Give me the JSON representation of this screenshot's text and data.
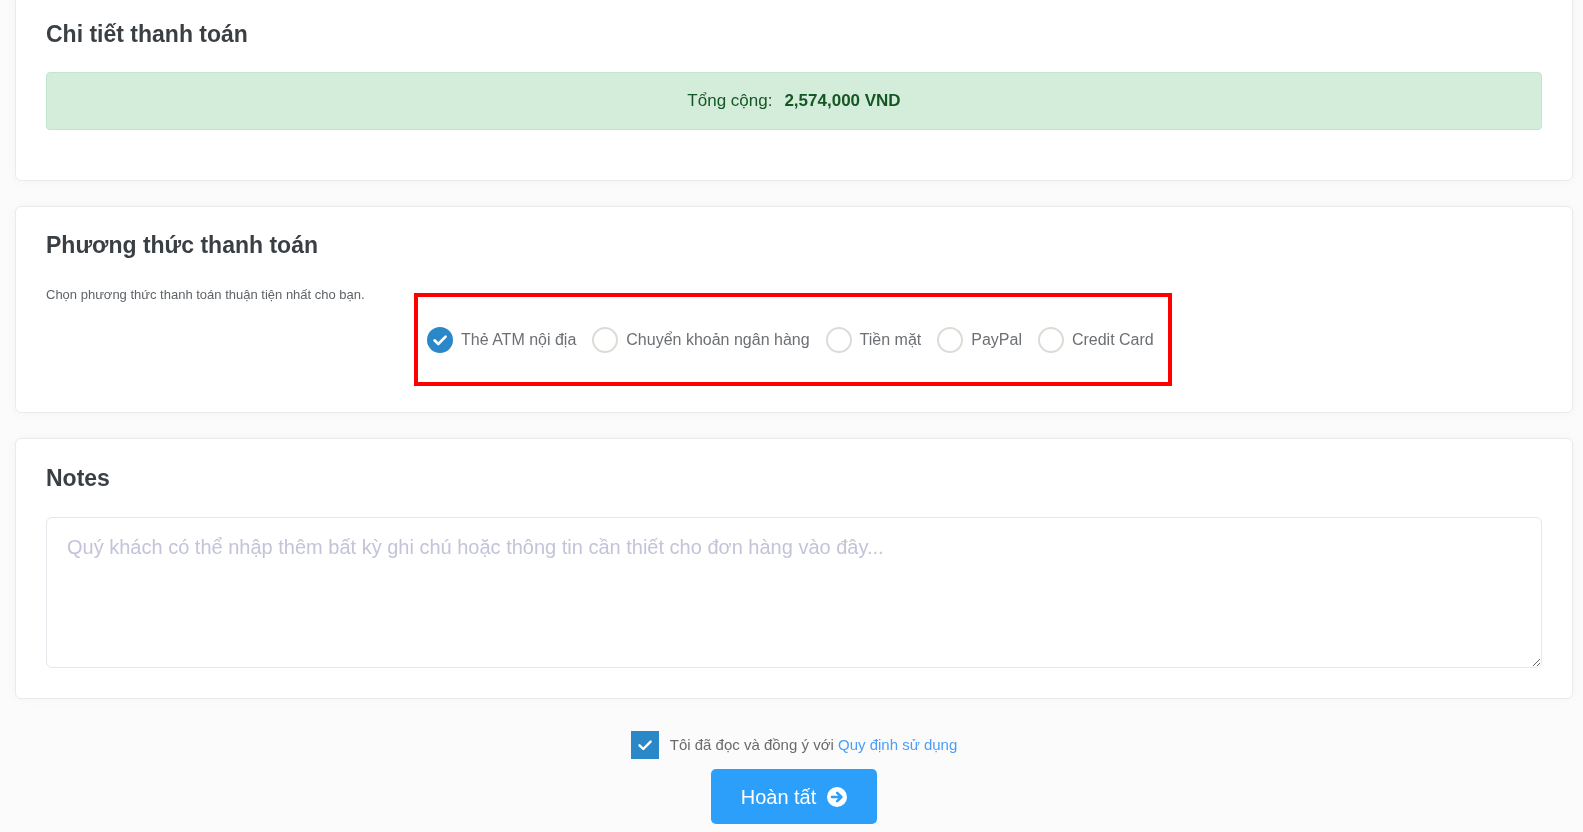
{
  "payment_details": {
    "title": "Chi tiết thanh toán",
    "total_label": "Tổng cộng:",
    "total_value": "2,574,000 VND"
  },
  "payment_method": {
    "title": "Phương thức thanh toán",
    "description": "Chọn phương thức thanh toán thuận tiện nhất cho bạn.",
    "options": [
      {
        "label": "Thẻ ATM nội địa",
        "selected": true
      },
      {
        "label": "Chuyển khoản ngân hàng",
        "selected": false
      },
      {
        "label": "Tiền mặt",
        "selected": false
      },
      {
        "label": "PayPal",
        "selected": false
      },
      {
        "label": "Credit Card",
        "selected": false
      }
    ]
  },
  "notes": {
    "title": "Notes",
    "placeholder": "Quý khách có thể nhập thêm bất kỳ ghi chú hoặc thông tin cần thiết cho đơn hàng vào đây..."
  },
  "agreement": {
    "checked": true,
    "text": "Tôi đã đọc và đồng ý với",
    "link": "Quy định sử dụng"
  },
  "submit_button": {
    "label": "Hoàn tất"
  }
}
